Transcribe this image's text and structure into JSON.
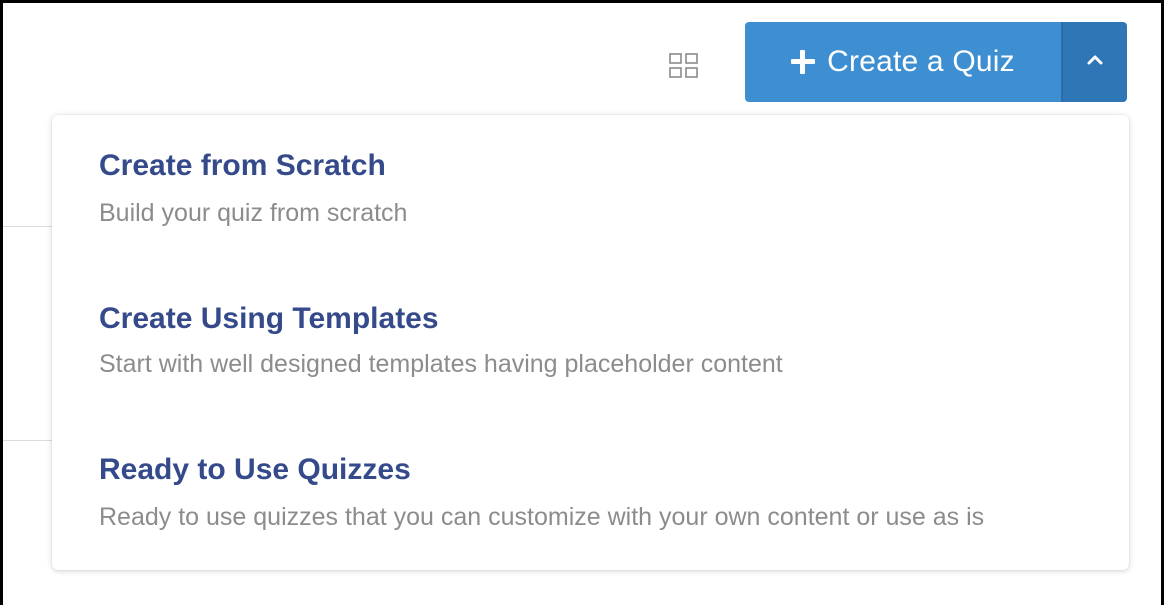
{
  "toolbar": {
    "view_toggle_icon": "grid-view-icon",
    "create_button": {
      "icon": "plus-icon",
      "label": "Create a Quiz"
    },
    "dropdown_toggle_icon": "chevron-up-icon"
  },
  "colors": {
    "primary": "#3d8fd1",
    "primary_dark": "#2f76b6",
    "menu_title": "#354a8a",
    "menu_desc": "#8c8c8c"
  },
  "dropdown": {
    "items": [
      {
        "title": "Create from Scratch",
        "description": "Build your quiz from scratch"
      },
      {
        "title": "Create Using Templates",
        "description": "Start with well designed templates having placeholder content"
      },
      {
        "title": "Ready to Use Quizzes",
        "description": "Ready to use quizzes that you can customize with your own content or use as is"
      }
    ]
  }
}
